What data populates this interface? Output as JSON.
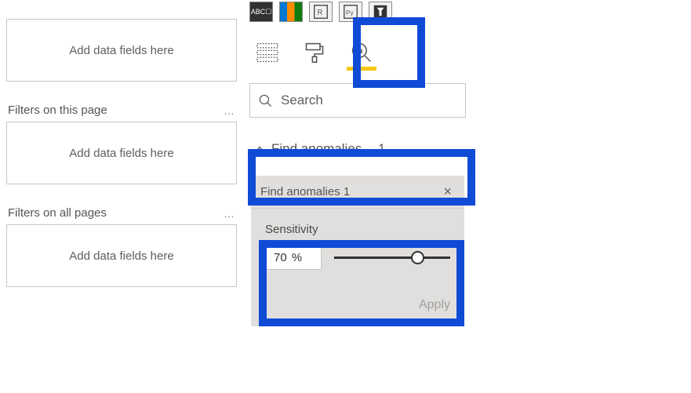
{
  "filters": {
    "dropzone_placeholder": "Add data fields here",
    "this_page_label": "Filters on this page",
    "all_pages_label": "Filters on all pages"
  },
  "search": {
    "placeholder": "Search"
  },
  "analytics": {
    "section_label": "Find anomalies",
    "section_count": "1",
    "item_title": "Find anomalies 1",
    "sensitivity_label": "Sensitivity",
    "sensitivity_value": "70",
    "sensitivity_unit": "%",
    "apply_label": "Apply"
  }
}
